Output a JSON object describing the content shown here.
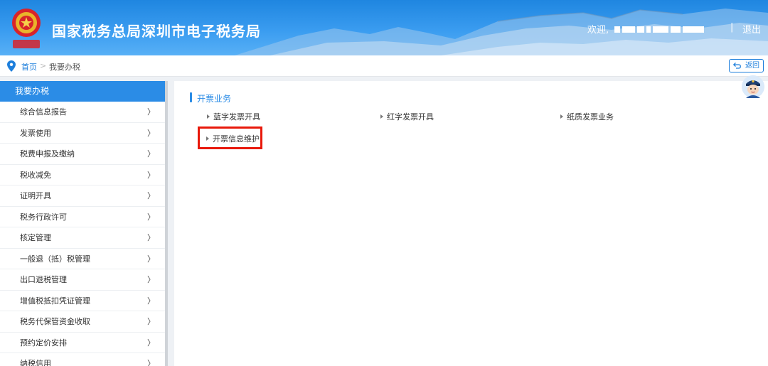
{
  "header": {
    "site_title": "国家税务总局深圳市电子税务局",
    "welcome": "欢迎,",
    "separator": "|",
    "logout": "退出"
  },
  "breadcrumb": {
    "home": "首页",
    "separator": ">",
    "current": "我要办税",
    "back": "返回"
  },
  "sidebar": {
    "title": "我要办税",
    "chevron": "〉",
    "items": [
      {
        "label": "综合信息报告"
      },
      {
        "label": "发票使用"
      },
      {
        "label": "税费申报及缴纳"
      },
      {
        "label": "税收减免"
      },
      {
        "label": "证明开具"
      },
      {
        "label": "税务行政许可"
      },
      {
        "label": "核定管理"
      },
      {
        "label": "一般退（抵）税管理"
      },
      {
        "label": "出口退税管理"
      },
      {
        "label": "增值税抵扣凭证管理"
      },
      {
        "label": "税务代保管资金收取"
      },
      {
        "label": "预约定价安排"
      },
      {
        "label": "纳税信用"
      }
    ]
  },
  "main": {
    "section_title": "开票业务",
    "links": [
      {
        "label": "蓝字发票开具"
      },
      {
        "label": "红字发票开具"
      },
      {
        "label": "纸质发票业务"
      },
      {
        "label": "开票信息维护"
      }
    ],
    "highlight_color": "#e8190b"
  },
  "colors": {
    "brand_blue": "#2b8ce6",
    "header_blue": "#1f86e0",
    "link_blue": "#1e7fdc"
  },
  "icons": [
    "tax-emblem-icon",
    "location-pin-icon",
    "back-arrow-icon",
    "chevron-right-icon",
    "assistant-avatar-icon"
  ]
}
